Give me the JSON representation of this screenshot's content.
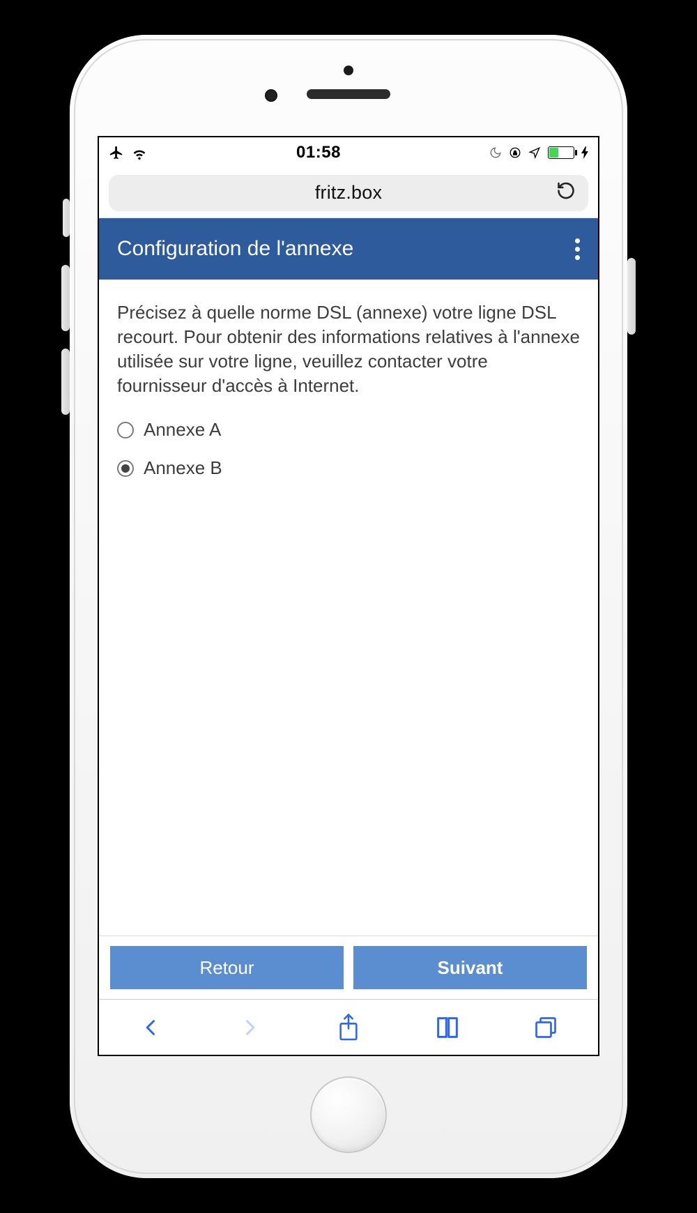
{
  "status": {
    "time": "01:58"
  },
  "browser": {
    "url_label": "fritz.box"
  },
  "page": {
    "header_title": "Configuration de l'annexe",
    "description": "Précisez à quelle norme DSL (annexe) votre ligne DSL recourt. Pour obtenir des informations relatives à l'annexe utilisée sur votre ligne, veuillez contacter votre fournisseur d'accès à Internet.",
    "options": [
      {
        "label": "Annexe A",
        "selected": false
      },
      {
        "label": "Annexe B",
        "selected": true
      }
    ],
    "actions": {
      "back_label": "Retour",
      "next_label": "Suivant"
    }
  }
}
